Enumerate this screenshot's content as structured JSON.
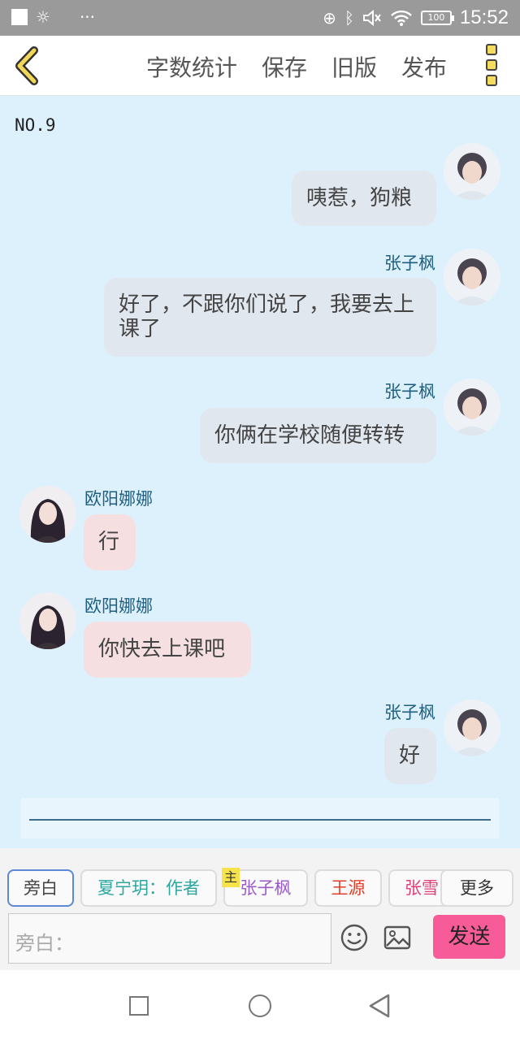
{
  "status_bar": {
    "time": "15:52",
    "battery": "100",
    "more_glyph": "···",
    "icons": [
      "white-square-icon",
      "sun-icon",
      "data-saver-icon",
      "bluetooth-icon",
      "mute-icon",
      "wifi-icon",
      "battery-icon"
    ]
  },
  "toolbar": {
    "word_count": "字数统计",
    "save": "保存",
    "old_version": "旧版",
    "publish": "发布"
  },
  "chat": {
    "number_label": "NO.9",
    "messages": [
      {
        "side": "right",
        "sender": "",
        "text": "咦惹，狗粮"
      },
      {
        "side": "right",
        "sender": "张子枫",
        "text": "好了，不跟你们说了，我要去上课了"
      },
      {
        "side": "right",
        "sender": "张子枫",
        "text": "你俩在学校随便转转"
      },
      {
        "side": "left",
        "sender": "欧阳娜娜",
        "text": "行"
      },
      {
        "side": "left",
        "sender": "欧阳娜娜",
        "text": "你快去上课吧"
      },
      {
        "side": "right",
        "sender": "张子枫",
        "text": "好"
      }
    ]
  },
  "roles": [
    {
      "label": "旁白",
      "color": "#444444",
      "badge": ""
    },
    {
      "label": "夏宁玥：作者",
      "color": "#2aa7a0",
      "badge": ""
    },
    {
      "label": "张子枫",
      "color": "#9a5cc8",
      "badge": "主"
    },
    {
      "label": "王源",
      "color": "#e0402a",
      "badge": ""
    },
    {
      "label": "张雪",
      "color": "#e0407a",
      "badge": ""
    }
  ],
  "more_label": "更多",
  "input": {
    "placeholder": "旁白："
  },
  "send_label": "发送",
  "colors": {
    "chat_bg": "#ddf1fd",
    "my_bubble": "#e1e7ef",
    "other_bubble": "#f5dfe1",
    "send_button": "#f85c98",
    "name_color": "#1f5f7f"
  }
}
